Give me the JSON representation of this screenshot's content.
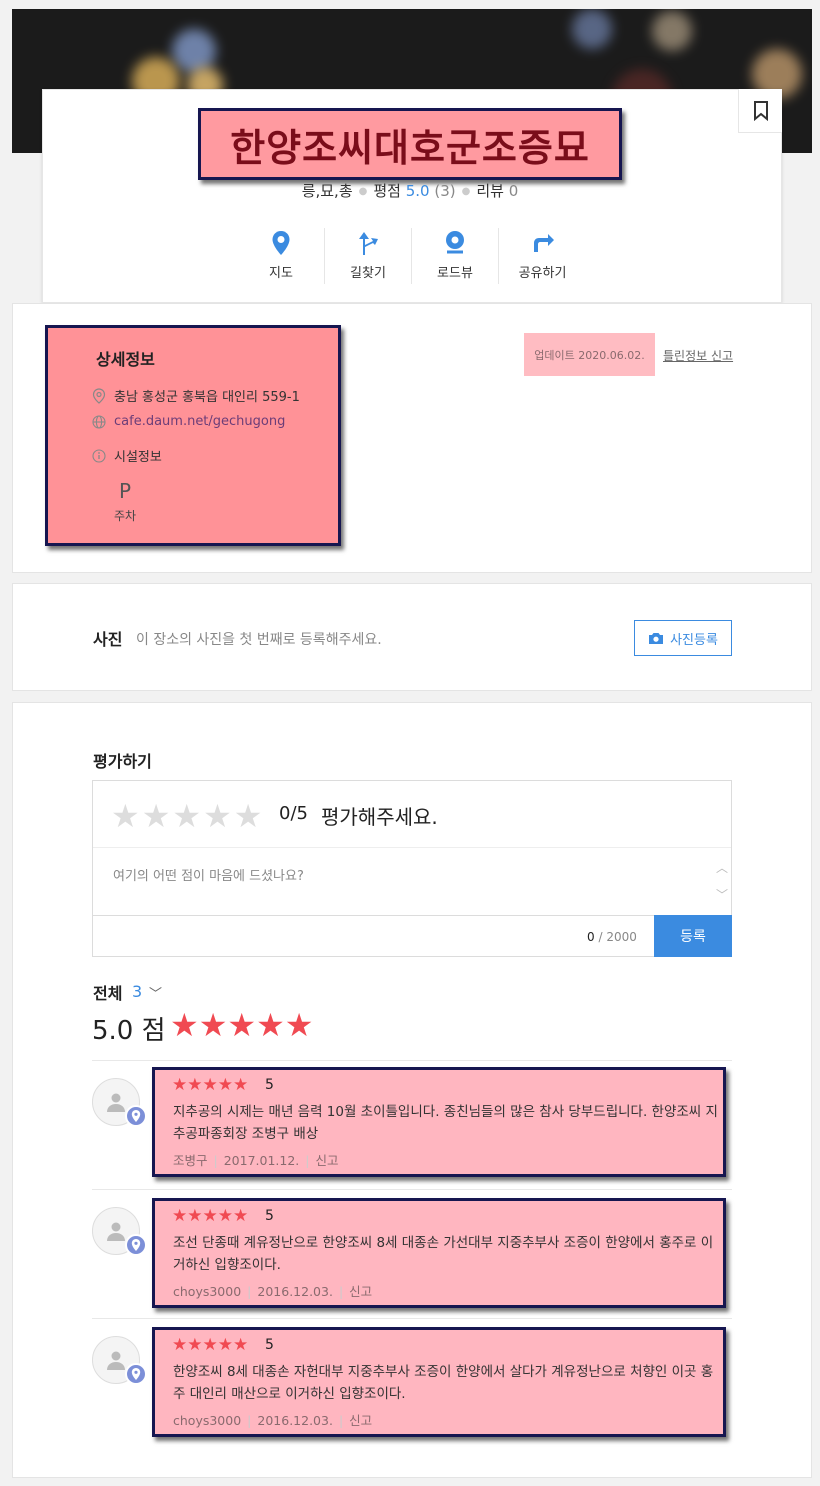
{
  "place": {
    "title": "한양조씨대호군조증묘",
    "category": "릉,묘,총",
    "rating_label": "평점",
    "rating_value": "5.0",
    "rating_count": "(3)",
    "review_label": "리뷰",
    "review_count": "0"
  },
  "actions": [
    {
      "label": "지도",
      "icon": "map-pin-icon"
    },
    {
      "label": "길찾기",
      "icon": "directions-icon"
    },
    {
      "label": "로드뷰",
      "icon": "roadview-icon"
    },
    {
      "label": "공유하기",
      "icon": "share-icon"
    }
  ],
  "detail": {
    "title": "상세정보",
    "address": "충남 홍성군 홍북읍 대인리 559-1",
    "website": "cafe.daum.net/gechugong",
    "facility_label": "시설정보",
    "parking_symbol": "P",
    "parking_label": "주차",
    "updated": "업데이트 2020.06.02.",
    "report": "틀린정보 신고"
  },
  "photo": {
    "title": "사진",
    "desc": "이 장소의 사진을 첫 번째로 등록해주세요.",
    "button": "사진등록"
  },
  "rating_form": {
    "title": "평가하기",
    "empty_stars": "★★★★★",
    "score": "0/5",
    "hint": "평가해주세요.",
    "placeholder": "여기의 어떤 점이 마음에 드셨나요?",
    "count_current": "0",
    "count_max": "/ 2000",
    "submit": "등록"
  },
  "summary": {
    "total_label": "전체",
    "total_count": "3",
    "avg": "5.0 점",
    "stars": "★★★★★"
  },
  "reviews": [
    {
      "stars": "★★★★★",
      "score": "5",
      "text": "지추공의 시제는 매년 음력 10월 초이틀입니다. 종친님들의 많은 참사 당부드립니다. 한양조씨 지추공파종회장 조병구 배상",
      "author": "조병구",
      "date": "2017.01.12.",
      "report": "신고"
    },
    {
      "stars": "★★★★★",
      "score": "5",
      "text": "조선 단종때 계유정난으로 한양조씨 8세 대종손 가선대부 지중추부사 조증이 한양에서 홍주로 이거하신 입향조이다.",
      "author": "choys3000",
      "date": "2016.12.03.",
      "report": "신고"
    },
    {
      "stars": "★★★★★",
      "score": "5",
      "text": "한양조씨 8세 대종손 자헌대부 지중추부사 조증이 한양에서 살다가 계유정난으로 처향인 이곳 홍주 대인리 매산으로 이거하신 입향조이다.",
      "author": "choys3000",
      "date": "2016.12.03.",
      "report": "신고"
    }
  ],
  "colors": {
    "accent": "#3b8be0",
    "star": "#f04a52",
    "highlight_title": "#ff9aa0",
    "highlight_review": "#ffb6c0"
  }
}
